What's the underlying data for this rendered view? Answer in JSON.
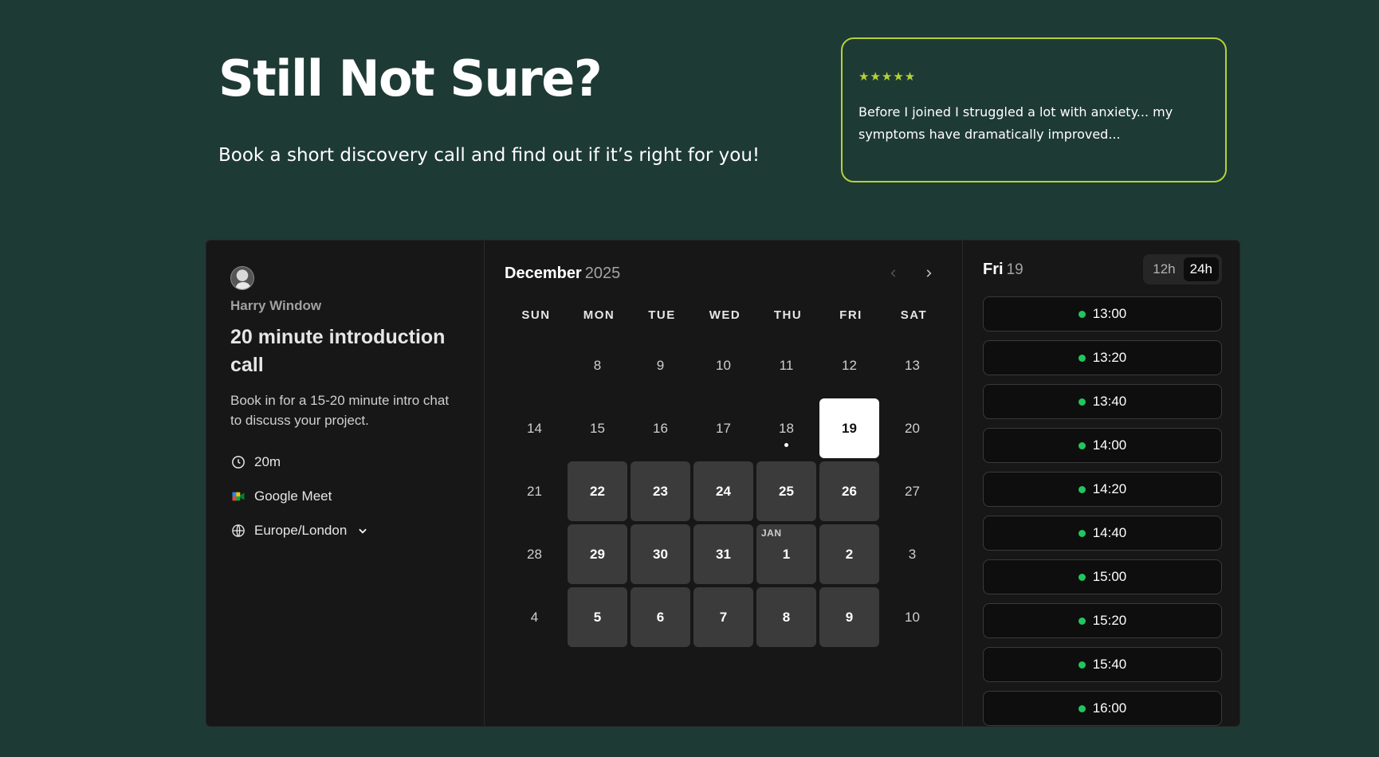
{
  "hero": {
    "title": "Still Not Sure?",
    "subtitle": "Book a short discovery call and find out if it’s right for you!"
  },
  "testimonial": {
    "stars": "★★★★★",
    "quote": "Before I joined I struggled a lot with anxiety... my symptoms have dramatically improved...",
    "accent_color": "#b3d339"
  },
  "event": {
    "host_name": "Harry Window",
    "title": "20 minute introduction call",
    "description": "Book in for a 15-20 minute intro chat to discuss your project.",
    "duration": "20m",
    "location": "Google Meet",
    "timezone": "Europe/London"
  },
  "calendar": {
    "month": "December",
    "year": "2025",
    "weekdays": [
      "SUN",
      "MON",
      "TUE",
      "WED",
      "THU",
      "FRI",
      "SAT"
    ],
    "days": [
      {
        "label": "",
        "state": "empty"
      },
      {
        "label": "8",
        "state": "unavailable"
      },
      {
        "label": "9",
        "state": "unavailable"
      },
      {
        "label": "10",
        "state": "unavailable"
      },
      {
        "label": "11",
        "state": "unavailable"
      },
      {
        "label": "12",
        "state": "unavailable"
      },
      {
        "label": "13",
        "state": "unavailable"
      },
      {
        "label": "14",
        "state": "unavailable"
      },
      {
        "label": "15",
        "state": "unavailable"
      },
      {
        "label": "16",
        "state": "unavailable"
      },
      {
        "label": "17",
        "state": "unavailable"
      },
      {
        "label": "18",
        "state": "today"
      },
      {
        "label": "19",
        "state": "selected"
      },
      {
        "label": "20",
        "state": "unavailable"
      },
      {
        "label": "21",
        "state": "unavailable"
      },
      {
        "label": "22",
        "state": "available"
      },
      {
        "label": "23",
        "state": "available"
      },
      {
        "label": "24",
        "state": "available"
      },
      {
        "label": "25",
        "state": "available"
      },
      {
        "label": "26",
        "state": "available"
      },
      {
        "label": "27",
        "state": "unavailable"
      },
      {
        "label": "28",
        "state": "unavailable"
      },
      {
        "label": "29",
        "state": "available"
      },
      {
        "label": "30",
        "state": "available"
      },
      {
        "label": "31",
        "state": "available"
      },
      {
        "label": "1",
        "state": "available",
        "month_tag": "JAN"
      },
      {
        "label": "2",
        "state": "available"
      },
      {
        "label": "3",
        "state": "unavailable"
      },
      {
        "label": "4",
        "state": "unavailable"
      },
      {
        "label": "5",
        "state": "available"
      },
      {
        "label": "6",
        "state": "available"
      },
      {
        "label": "7",
        "state": "available"
      },
      {
        "label": "8",
        "state": "available"
      },
      {
        "label": "9",
        "state": "available"
      },
      {
        "label": "10",
        "state": "unavailable"
      }
    ]
  },
  "slots": {
    "day": "Fri",
    "date": "19",
    "format_options": [
      "12h",
      "24h"
    ],
    "selected_format": "24h",
    "available_color": "#22c55e",
    "times": [
      "13:00",
      "13:20",
      "13:40",
      "14:00",
      "14:20",
      "14:40",
      "15:00",
      "15:20",
      "15:40",
      "16:00"
    ]
  }
}
